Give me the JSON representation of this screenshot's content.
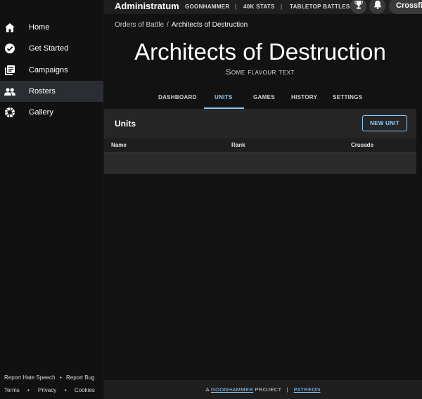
{
  "sidebar": {
    "items": [
      {
        "label": "Home",
        "icon": "home-icon"
      },
      {
        "label": "Get Started",
        "icon": "check-circle-icon"
      },
      {
        "label": "Campaigns",
        "icon": "library-icon"
      },
      {
        "label": "Rosters",
        "icon": "people-icon",
        "active": true
      },
      {
        "label": "Gallery",
        "icon": "camera-shutter-icon"
      }
    ],
    "footer": {
      "report_hate": "Report Hate Speech",
      "report_bug": "Report Bug",
      "terms": "Terms",
      "privacy": "Privacy",
      "cookies": "Cookies",
      "dot": "•"
    }
  },
  "topbar": {
    "brand": "Administratum",
    "links": [
      "GOONHAMMER",
      "40K STATS",
      "TABLETOP BATTLES"
    ],
    "sep": "|",
    "user": "Crossfire"
  },
  "breadcrumb": {
    "parent": "Orders of Battle",
    "sep": "/",
    "current": "Architects of Destruction"
  },
  "page": {
    "title": "Architects of Destruction",
    "subtitle": "Some flavour text"
  },
  "tabs": [
    "DASHBOARD",
    "UNITS",
    "GAMES",
    "HISTORY",
    "SETTINGS"
  ],
  "active_tab": "UNITS",
  "units": {
    "title": "Units",
    "new_unit": "NEW UNIT",
    "columns": [
      "Name",
      "Rank",
      "Crusade"
    ],
    "rows": []
  },
  "footer": {
    "prefix": "A",
    "link1": "GOONHAMMER",
    "mid": "PROJECT",
    "sep": "|",
    "link2": "PATREON"
  },
  "colors": {
    "accent": "#90caf9",
    "sidebar_active": "#2a2e33",
    "background": "#121212"
  }
}
